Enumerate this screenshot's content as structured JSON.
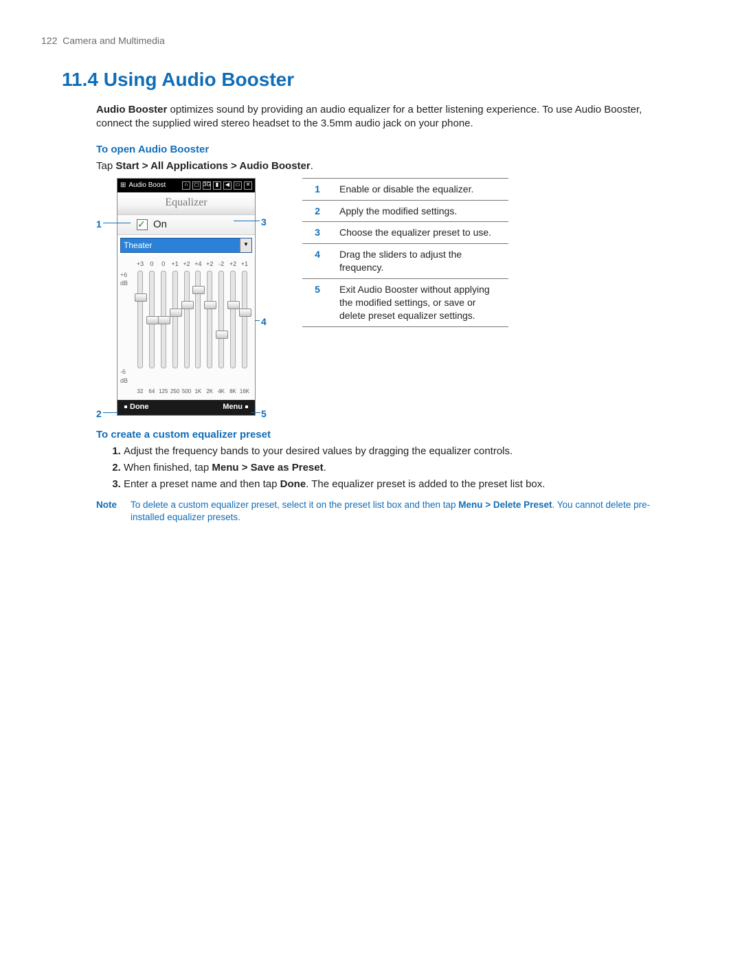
{
  "page": {
    "number": "122",
    "chapter": "Camera and Multimedia"
  },
  "h1": "11.4  Using Audio Booster",
  "intro": {
    "lead": "Audio Booster",
    "rest": " optimizes sound by providing an audio equalizer for a better listening experience. To use Audio Booster, connect the supplied wired stereo headset to the 3.5mm audio jack on your phone."
  },
  "sub1": "To open Audio Booster",
  "tap": {
    "pre": "Tap ",
    "path": "Start > All Applications > Audio Booster",
    "post": "."
  },
  "app": {
    "titlebar": "Audio Boost",
    "title": "Equalizer",
    "on": "On",
    "preset": "Theater",
    "db_top": "+6\ndB",
    "db_bot": "-6\ndB",
    "slider_vals": [
      "+3",
      "0",
      "0",
      "+1",
      "+2",
      "+4",
      "+2",
      "-2",
      "+2",
      "+1"
    ],
    "slider_freq": [
      "32",
      "64",
      "125",
      "250",
      "500",
      "1K",
      "2K",
      "4K",
      "8K",
      "16K"
    ],
    "soft_left": "Done",
    "soft_right": "Menu"
  },
  "callouts": {
    "c1": "1",
    "c2": "2",
    "c3": "3",
    "c4": "4",
    "c5": "5"
  },
  "table": [
    {
      "n": "1",
      "t": "Enable or disable the equalizer."
    },
    {
      "n": "2",
      "t": "Apply the modified settings."
    },
    {
      "n": "3",
      "t": "Choose the equalizer preset to use."
    },
    {
      "n": "4",
      "t": "Drag the sliders to adjust the frequency."
    },
    {
      "n": "5",
      "t": "Exit Audio Booster without applying the modified settings, or save or delete preset equalizer settings."
    }
  ],
  "sub2": "To create a custom equalizer preset",
  "steps": [
    {
      "t1": "Adjust the frequency bands to your desired values by dragging the equalizer controls."
    },
    {
      "t1": "When finished, tap ",
      "b": "Menu > Save as Preset",
      "t2": "."
    },
    {
      "t1": "Enter a preset name and then tap ",
      "b": "Done",
      "t2": ". The equalizer preset is added to the preset list box."
    }
  ],
  "note": {
    "label": "Note",
    "t1": "To delete a custom equalizer preset, select it on the preset list box and then tap ",
    "b": "Menu > Delete Preset",
    "t2": ". You cannot delete pre-installed equalizer presets."
  }
}
